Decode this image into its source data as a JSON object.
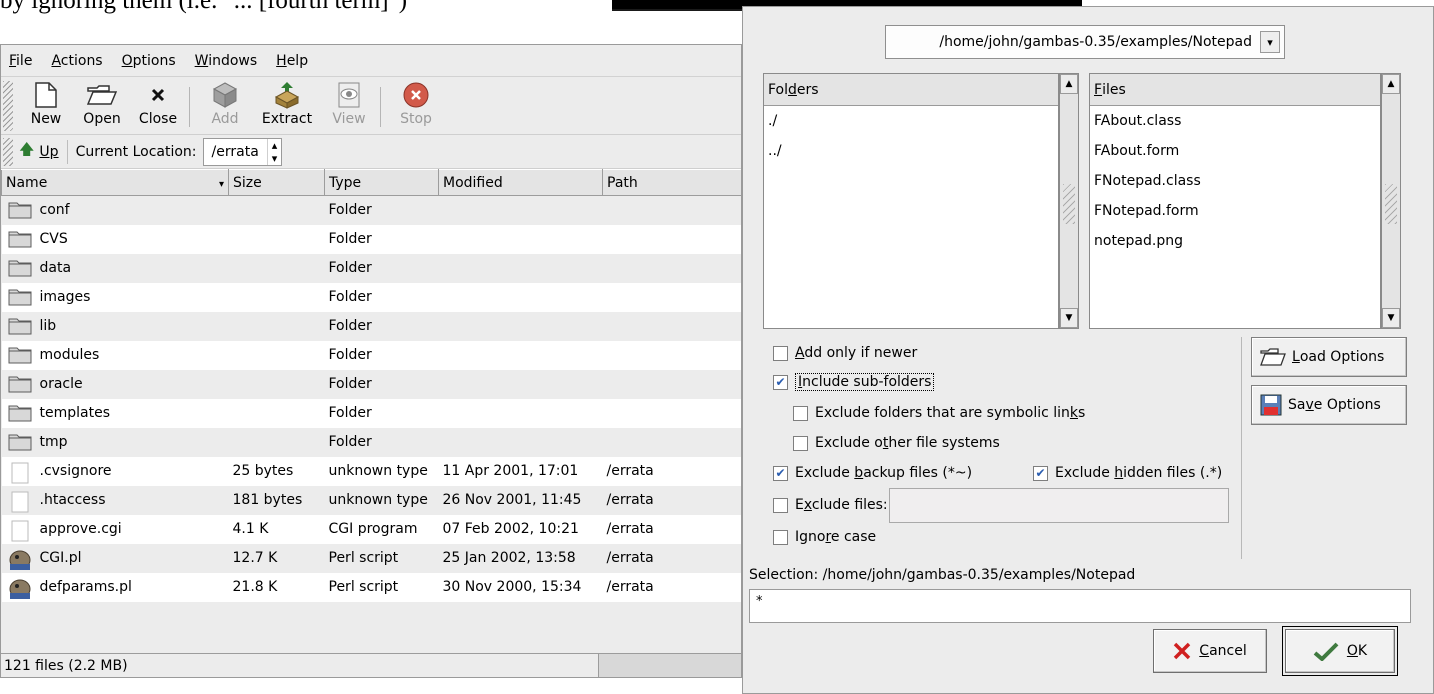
{
  "doc": {
    "caption": "by ignoring them (i.e. \"... [fourth term]\")"
  },
  "file_roller": {
    "menu": [
      {
        "label": "File",
        "mn": "F",
        "rest": "ile"
      },
      {
        "label": "Actions",
        "mn": "A",
        "rest": "ctions"
      },
      {
        "label": "Options",
        "mn": "O",
        "rest": "ptions"
      },
      {
        "label": "Windows",
        "mn": "W",
        "rest": "indows"
      },
      {
        "label": "Help",
        "mn": "H",
        "rest": "elp"
      }
    ],
    "toolbar": {
      "new": "New",
      "open": "Open",
      "close": "Close",
      "add": "Add",
      "extract": "Extract",
      "view": "View",
      "stop": "Stop"
    },
    "location": {
      "up": "Up",
      "label": "Current Location:",
      "value": "/errata"
    },
    "columns": {
      "name": "Name",
      "size": "Size",
      "type": "Type",
      "modified": "Modified",
      "path": "Path"
    },
    "rows": [
      {
        "name": "conf",
        "size": "",
        "type": "Folder",
        "modified": "",
        "path": "",
        "icon": "folder-icon"
      },
      {
        "name": "CVS",
        "size": "",
        "type": "Folder",
        "modified": "",
        "path": "",
        "icon": "folder-icon"
      },
      {
        "name": "data",
        "size": "",
        "type": "Folder",
        "modified": "",
        "path": "",
        "icon": "folder-icon"
      },
      {
        "name": "images",
        "size": "",
        "type": "Folder",
        "modified": "",
        "path": "",
        "icon": "folder-icon"
      },
      {
        "name": "lib",
        "size": "",
        "type": "Folder",
        "modified": "",
        "path": "",
        "icon": "folder-icon"
      },
      {
        "name": "modules",
        "size": "",
        "type": "Folder",
        "modified": "",
        "path": "",
        "icon": "folder-icon"
      },
      {
        "name": "oracle",
        "size": "",
        "type": "Folder",
        "modified": "",
        "path": "",
        "icon": "folder-icon"
      },
      {
        "name": "templates",
        "size": "",
        "type": "Folder",
        "modified": "",
        "path": "",
        "icon": "folder-icon"
      },
      {
        "name": "tmp",
        "size": "",
        "type": "Folder",
        "modified": "",
        "path": "",
        "icon": "folder-icon"
      },
      {
        "name": ".cvsignore",
        "size": "25 bytes",
        "type": "unknown type",
        "modified": "11 Apr 2001, 17:01",
        "path": "/errata",
        "icon": "file-icon"
      },
      {
        "name": ".htaccess",
        "size": "181 bytes",
        "type": "unknown type",
        "modified": "26 Nov 2001, 11:45",
        "path": "/errata",
        "icon": "file-icon"
      },
      {
        "name": "approve.cgi",
        "size": "4.1 K",
        "type": "CGI program",
        "modified": "07 Feb 2002, 10:21",
        "path": "/errata",
        "icon": "file-icon"
      },
      {
        "name": "CGI.pl",
        "size": "12.7 K",
        "type": "Perl script",
        "modified": "25 Jan 2002, 13:58",
        "path": "/errata",
        "icon": "perl-icon"
      },
      {
        "name": "defparams.pl",
        "size": "21.8 K",
        "type": "Perl script",
        "modified": "30 Nov 2000, 15:34",
        "path": "/errata",
        "icon": "perl-icon"
      }
    ],
    "status": "121 files (2.2 MB)"
  },
  "dialog": {
    "path": "/home/john/gambas-0.35/examples/Notepad",
    "folders_header": {
      "pre": "Fol",
      "mn": "d",
      "post": "ers"
    },
    "folders": [
      "./",
      "../"
    ],
    "files_header": {
      "pre": "",
      "mn": "F",
      "post": "iles"
    },
    "files": [
      "FAbout.class",
      "FAbout.form",
      "FNotepad.class",
      "FNotepad.form",
      "notepad.png"
    ],
    "options": {
      "add_newer": {
        "pre": "",
        "mn": "A",
        "post": "dd only if newer",
        "checked": false
      },
      "include_sub": {
        "pre": "",
        "mn": "I",
        "post": "nclude sub-folders",
        "checked": true
      },
      "excl_symlinks": {
        "pre": "Exclude folders that are symbolic lin",
        "mn": "k",
        "post": "s",
        "checked": false
      },
      "excl_other_fs": {
        "pre": "Exclude o",
        "mn": "t",
        "post": "her file systems",
        "checked": false
      },
      "excl_backup": {
        "pre": "Exclude ",
        "mn": "b",
        "post": "ackup files (*~)",
        "checked": true
      },
      "excl_hidden": {
        "pre": "Exclude ",
        "mn": "h",
        "post": "idden files (.*)",
        "checked": true
      },
      "excl_files": {
        "pre": "E",
        "mn": "x",
        "post": "clude files:",
        "checked": false
      },
      "ignore_case": {
        "pre": "Igno",
        "mn": "r",
        "post": "e case",
        "checked": false
      }
    },
    "load_options": {
      "pre": "",
      "mn": "L",
      "post": "oad Options"
    },
    "save_options": {
      "pre": "Sa",
      "mn": "v",
      "post": "e Options"
    },
    "selection_label": "Selection: /home/john/gambas-0.35/examples/Notepad",
    "selection_value": "*",
    "cancel": {
      "pre": "",
      "mn": "C",
      "post": "ancel"
    },
    "ok": {
      "pre": "",
      "mn": "O",
      "post": "K"
    }
  }
}
